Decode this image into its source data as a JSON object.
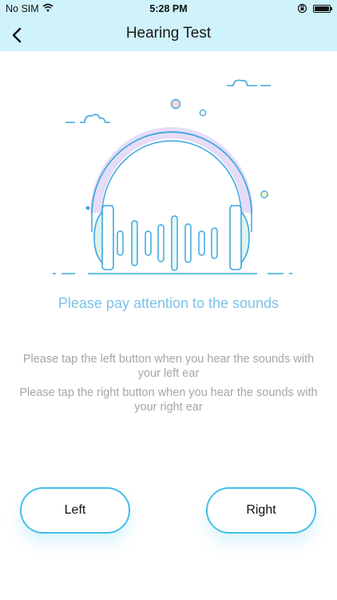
{
  "status_bar": {
    "carrier": "No SIM",
    "time": "5:28 PM"
  },
  "header": {
    "title": "Hearing Test",
    "back_icon": "chevron-left-icon"
  },
  "main": {
    "subtitle": "Please pay attention to the sounds",
    "instruction_left": "Please tap the left button when you hear the sounds with your left ear",
    "instruction_right": "Please tap the right button when you hear the sounds with your right ear"
  },
  "buttons": {
    "left_label": "Left",
    "right_label": "Right"
  },
  "colors": {
    "header_bg": "#cff2fb",
    "accent_blue": "#42c0ea",
    "subtitle_blue": "#7cc3ea",
    "instruction_gray": "#a6a6a6"
  }
}
